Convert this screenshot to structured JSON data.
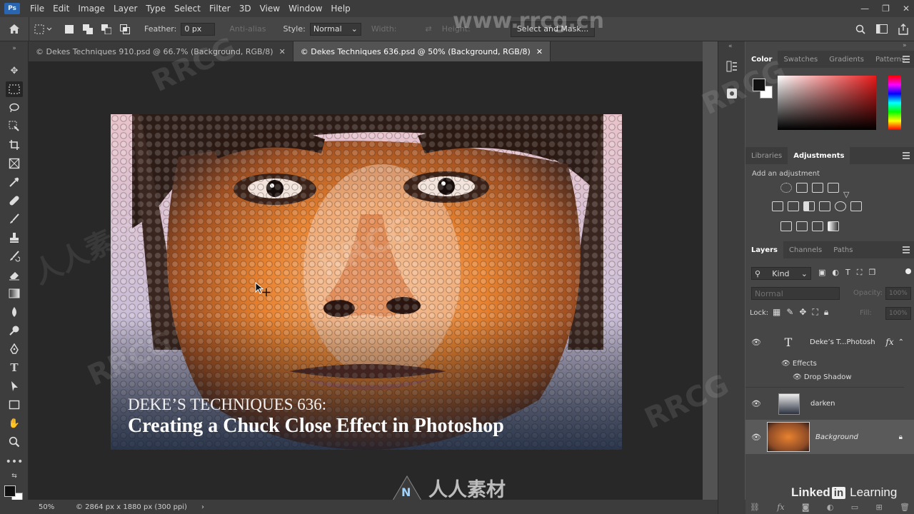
{
  "menubar": {
    "logo": "Ps",
    "items": [
      "File",
      "Edit",
      "Image",
      "Layer",
      "Type",
      "Select",
      "Filter",
      "3D",
      "View",
      "Window",
      "Help"
    ],
    "window_controls": [
      "—",
      "❐",
      "✕"
    ]
  },
  "options": {
    "feather_label": "Feather:",
    "feather_value": "0 px",
    "antialias_label": "Anti-alias",
    "style_label": "Style:",
    "style_value": "Normal",
    "width_label": "Width:",
    "height_label": "Height:",
    "select_mask_label": "Select and Mask..."
  },
  "tabs": [
    {
      "label": "© Dekes Techniques 910.psd @ 66.7% (Background, RGB/8)",
      "active": false
    },
    {
      "label": "© Dekes Techniques 636.psd @ 50% (Background, RGB/8)",
      "active": true
    }
  ],
  "canvas": {
    "caption_line1": "DEKE’S TECHNIQUES 636:",
    "caption_line2": "Creating a Chuck Close Effect in Photoshop"
  },
  "status": {
    "zoom": "50%",
    "doc_info": "© 2864 px x 1880 px (300 ppi)",
    "arrow": "›"
  },
  "color_panel": {
    "tabs": [
      "Color",
      "Swatches",
      "Gradients",
      "Patterns"
    ],
    "active": "Color"
  },
  "adjust_panel": {
    "tabs": [
      "Libraries",
      "Adjustments"
    ],
    "active": "Adjustments",
    "hint": "Add an adjustment"
  },
  "layers_panel": {
    "tabs": [
      "Layers",
      "Channels",
      "Paths"
    ],
    "active": "Layers",
    "kind_label": "Kind",
    "blend_mode": "Normal",
    "opacity_label": "Opacity:",
    "opacity_value": "100%",
    "lock_label": "Lock:",
    "fill_label": "Fill:",
    "fill_value": "100%",
    "layers": [
      {
        "name": "Deke’s T...Photosh",
        "fx": "fx"
      },
      {
        "effects_label": "Effects",
        "drop_shadow_label": "Drop Shadow"
      },
      {
        "name": "darken"
      },
      {
        "name": "Background"
      }
    ]
  },
  "branding": {
    "watermark_text": "RRCG",
    "watermark_site": "www.rrcg.cn",
    "watermark_cn": "人人素材",
    "linkedin_main": "Linked",
    "linkedin_in": "in",
    "linkedin_learning": "Learning",
    "bottom_logo_text": "人人素材"
  },
  "colors": {
    "accent_blue": "#2a65b0",
    "canvas_bg": "#282828",
    "panel_bg": "#464646"
  }
}
